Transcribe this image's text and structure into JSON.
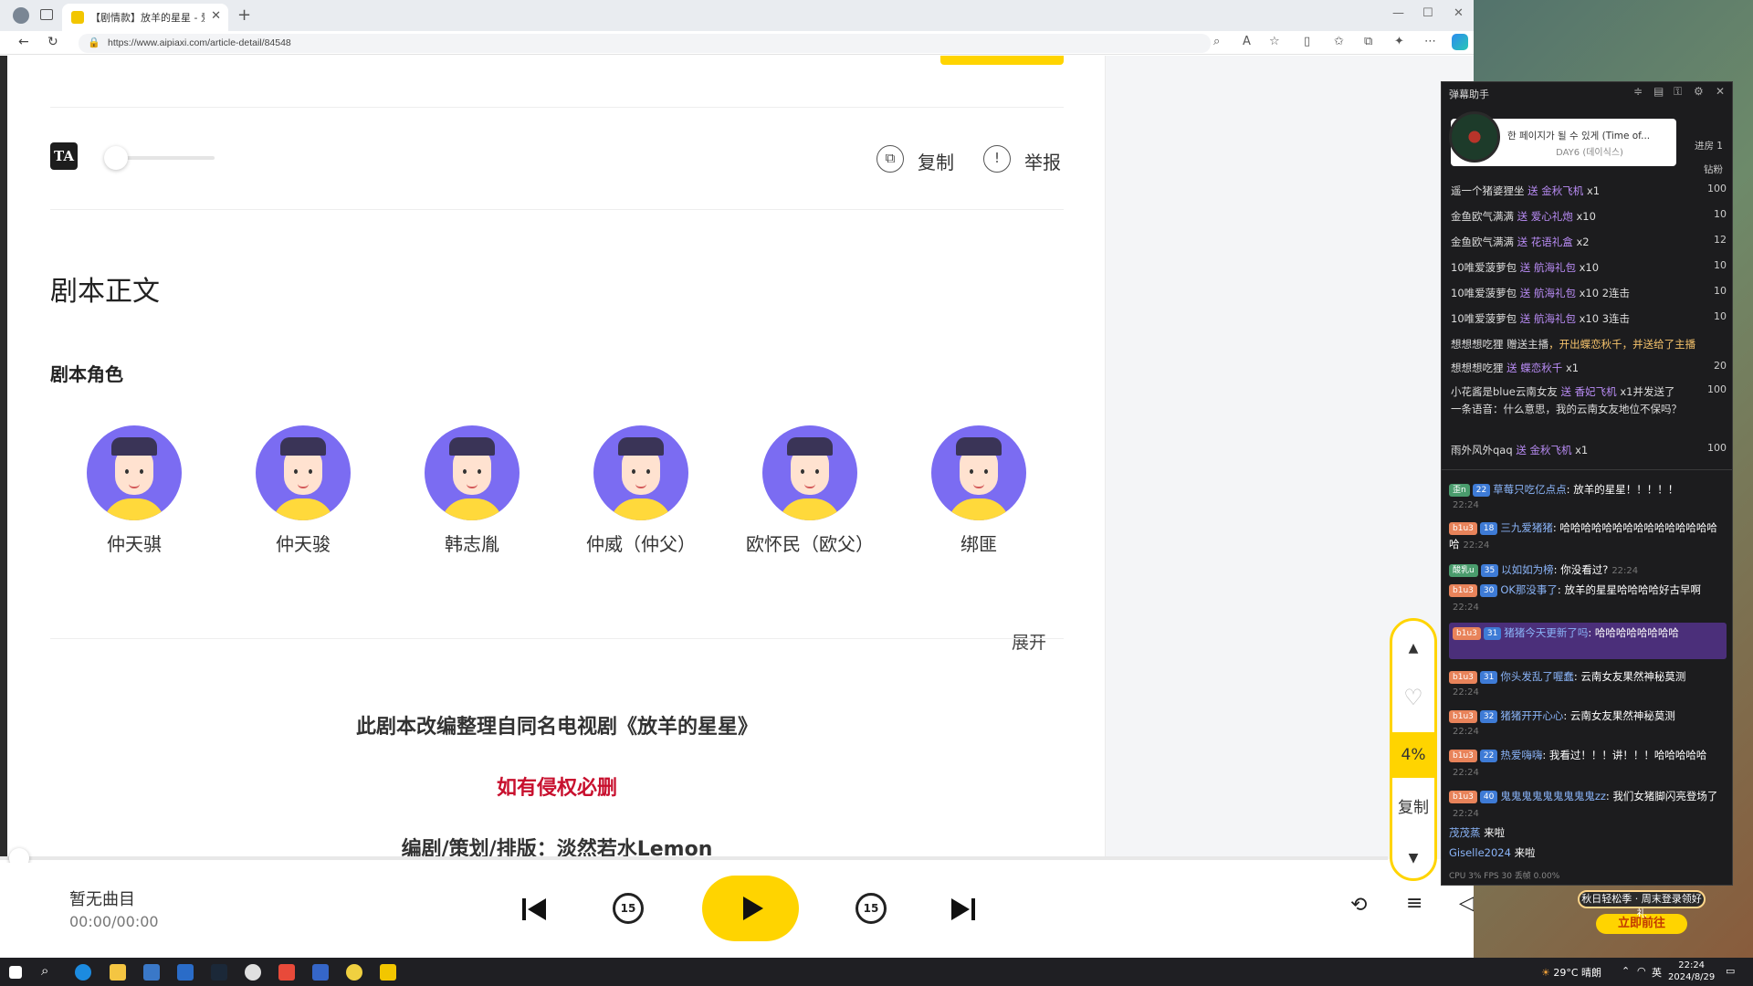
{
  "browser": {
    "tab_title": "【剧情款】放羊的星星 - 爱Pia戏",
    "url": "https://www.aipiaxi.com/article-detail/84548"
  },
  "toolbar": {
    "copy_label": "复制",
    "report_label": "举报",
    "font_icon_text": "TA"
  },
  "content": {
    "heading": "剧本正文",
    "roles_heading": "剧本角色",
    "roles": [
      "仲天骐",
      "仲天骏",
      "韩志胤",
      "仲威（仲父）",
      "欧怀民（欧父）",
      "绑匪"
    ],
    "expand_label": "展开",
    "para1": "此剧本改编整理自同名电视剧《放羊的星星》",
    "para2": "如有侵权必删",
    "para3": "编剧/策划/排版：淡然若水Lemon"
  },
  "player": {
    "song": "暂无曲目",
    "time": "00:00/00:00",
    "rewind_label": "15",
    "forward_label": "15"
  },
  "floatbar": {
    "percent": "4%",
    "copy_label": "复制"
  },
  "danmaku": {
    "title": "弹幕助手",
    "song_title": "한 페이지가 될 수 있게 (Time of...",
    "song_artist": "DAY6 (데이식스)",
    "rank_label": "进房 1",
    "coin_label": "钻粉",
    "gifts": [
      {
        "user": "遥一个猪婆狸坐",
        "action": "送 金秋飞机",
        "count": "x1",
        "value": "100"
      },
      {
        "user": "金鱼欧气满满",
        "action": "送 爱心礼炮",
        "count": "x10",
        "value": "10"
      },
      {
        "user": "金鱼欧气满满",
        "action": "送 花语礼盒",
        "count": "x2",
        "value": "12"
      },
      {
        "user": "10唯爱菠萝包",
        "action": "送 航海礼包",
        "count": "x10",
        "value": "10"
      },
      {
        "user": "10唯爱菠萝包",
        "action": "送 航海礼包",
        "count": "x10 2连击",
        "value": "10"
      },
      {
        "user": "10唯爱菠萝包",
        "action": "送 航海礼包",
        "count": "x10 3连击",
        "value": "10"
      },
      {
        "user": "想想想吃狸",
        "action": "赠送主播",
        "count": "，开出蝶恋秋千，并送给了主播",
        "value": ""
      },
      {
        "user": "想想想吃狸",
        "action": "送 蝶恋秋千",
        "count": "x1",
        "value": "20"
      },
      {
        "user": "小花酱是blue云南女友",
        "action": "送 香妃飞机",
        "count": "x1并发送了一条语音：什么意思，我的云南女友地位不保吗？",
        "value": "100"
      },
      {
        "user": "雨外风外qaq",
        "action": "送 金秋飞机",
        "count": "x1",
        "value": "100"
      }
    ],
    "chats": [
      {
        "badge": "歪n",
        "level": "22",
        "user": "草莓只吃亿点点",
        "text": "放羊的星星！！！！！",
        "time": "22:24"
      },
      {
        "badge": "b1u3",
        "level": "18",
        "user": "三九爱猪猪",
        "text": "哈哈哈哈哈哈哈哈哈哈哈哈哈哈哈哈",
        "time": "22:24"
      },
      {
        "badge": "酸乳u",
        "level": "35",
        "user": "以如如为榜",
        "text": "你没看过?",
        "time": "22:24"
      },
      {
        "badge": "b1u3",
        "level": "30",
        "user": "OK那没事了",
        "text": "放羊的星星哈哈哈哈好古早啊",
        "time": "22:24"
      },
      {
        "badge": "b1u3",
        "level": "31",
        "user": "猪猪今天更新了吗",
        "text": "哈哈哈哈哈哈哈哈",
        "time": ""
      },
      {
        "badge": "b1u3",
        "level": "31",
        "user": "你头发乱了喔蠢",
        "text": "云南女友果然神秘莫测",
        "time": "22:24"
      },
      {
        "badge": "b1u3",
        "level": "32",
        "user": "猪猪开开心心",
        "text": "云南女友果然神秘莫测",
        "time": "22:24"
      },
      {
        "badge": "b1u3",
        "level": "22",
        "user": "热爱嗨嗨",
        "text": "我看过！！！讲！！！哈哈哈哈哈",
        "time": "22:24"
      },
      {
        "badge": "b1u3",
        "level": "40",
        "user": "鬼鬼鬼鬼鬼鬼鬼鬼鬼zz",
        "text": "我们女猪脚闪亮登场了",
        "time": "22:24"
      },
      {
        "badge": "",
        "level": "",
        "user": "茂茂蒸",
        "text": "来啦",
        "time": ""
      },
      {
        "badge": "",
        "level": "",
        "user": "Giselle2024",
        "text": "来啦",
        "time": ""
      }
    ],
    "footer": "CPU 3%       FPS 30       丢帧 0.00%"
  },
  "ad": {
    "top": "秋日轻松季 · 周末登录领好礼",
    "button": "立即前往"
  },
  "taskbar": {
    "weather": "29°C 晴朗",
    "ime": "英",
    "time": "22:24",
    "date": "2024/8/29"
  }
}
